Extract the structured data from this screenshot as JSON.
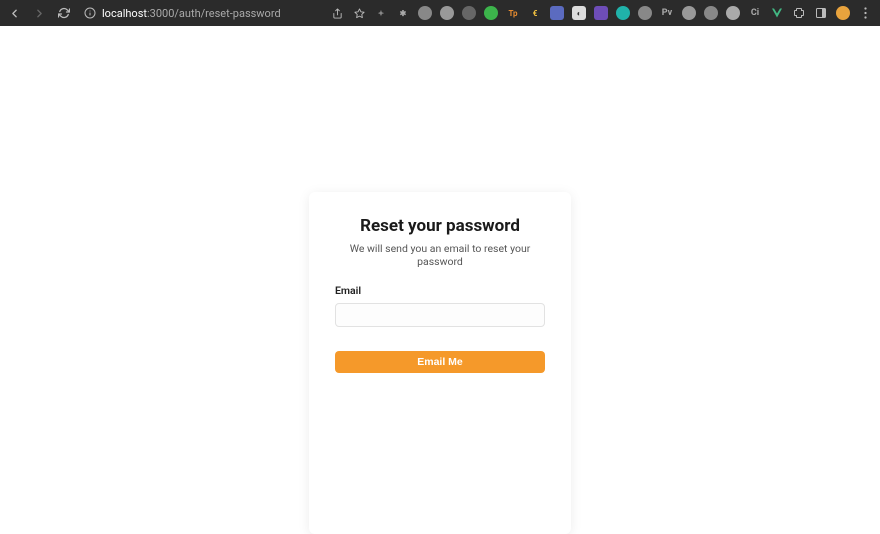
{
  "browser": {
    "url_host": "localhost",
    "url_port": ":3000",
    "url_path": "/auth/reset-password"
  },
  "page": {
    "title": "Reset your password",
    "subtitle": "We will send you an email to reset your password",
    "email_label": "Email",
    "email_value": "",
    "email_placeholder": "",
    "submit_label": "Email Me"
  },
  "colors": {
    "accent": "#f5992a"
  }
}
